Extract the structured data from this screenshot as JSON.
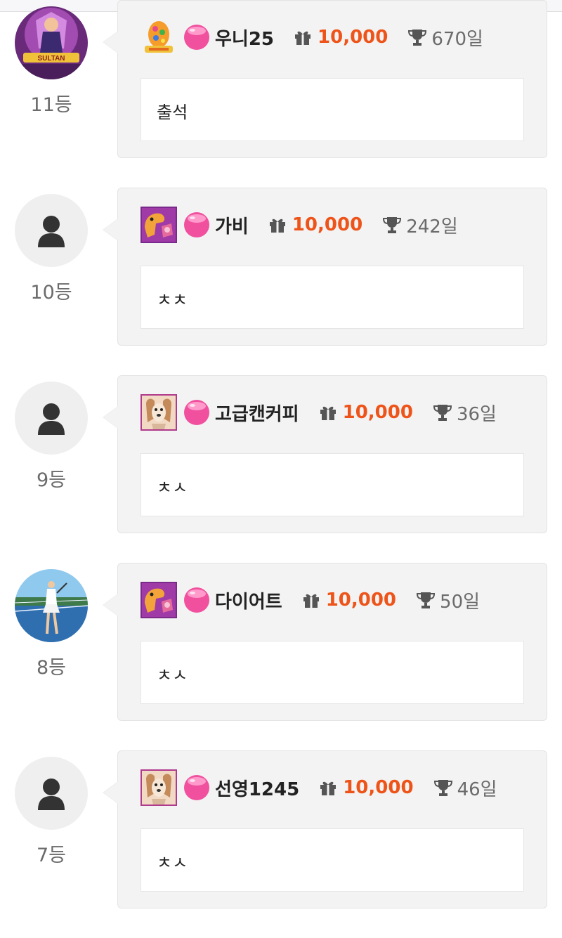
{
  "entries": [
    {
      "rank": "11등",
      "nickname": "우니25",
      "gift_amount": "10,000",
      "streak": "670일",
      "message": "출석",
      "avatar": "custom-photo",
      "badge": "easter-egg-badge"
    },
    {
      "rank": "10등",
      "nickname": "가비",
      "gift_amount": "10,000",
      "streak": "242일",
      "message": "ㅊㅊ",
      "avatar": "default-user-icon",
      "badge": "dinosaur-badge"
    },
    {
      "rank": "9등",
      "nickname": "고급캔커피",
      "gift_amount": "10,000",
      "streak": "36일",
      "message": "ㅊㅅ",
      "avatar": "default-user-icon",
      "badge": "dog-badge"
    },
    {
      "rank": "8등",
      "nickname": "다이어트",
      "gift_amount": "10,000",
      "streak": "50일",
      "message": "ㅊㅅ",
      "avatar": "tennis-photo",
      "badge": "dinosaur-badge"
    },
    {
      "rank": "7등",
      "nickname": "선영1245",
      "gift_amount": "10,000",
      "streak": "46일",
      "message": "ㅊㅅ",
      "avatar": "default-user-icon",
      "badge": "dog-badge"
    }
  ],
  "colors": {
    "gift_amount": "#ee5419",
    "card_background": "#f3f3f3",
    "rank_text": "#6b6b6b",
    "gem": "#f0509e"
  }
}
